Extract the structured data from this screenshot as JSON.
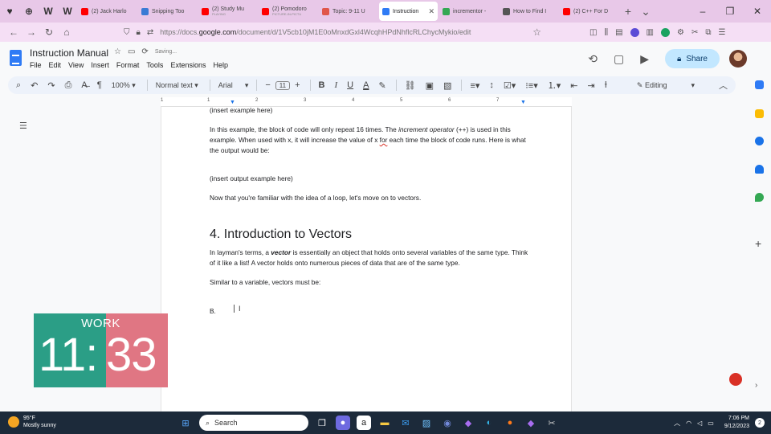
{
  "browser": {
    "tabs": [
      {
        "title": "(2) Jack Harlo",
        "color": "#ff0000",
        "subtitle": ""
      },
      {
        "title": "Snipping Too",
        "color": "#3a7bd5",
        "subtitle": ""
      },
      {
        "title": "(2) Study Mu",
        "color": "#ff0000",
        "subtitle": "PLAYING"
      },
      {
        "title": "(2) Pomodoro",
        "color": "#ff0000",
        "subtitle": "PICTURE-IN-PICTU"
      },
      {
        "title": "Topic: 9-11 U",
        "color": "#e0564a",
        "subtitle": ""
      },
      {
        "title": "Instruction",
        "color": "#2f7bf5",
        "subtitle": "",
        "active": true
      },
      {
        "title": "incrementor -",
        "color": "#34a853",
        "subtitle": ""
      },
      {
        "title": "How to Find I",
        "color": "#555555",
        "subtitle": ""
      },
      {
        "title": "(2) C++ For D",
        "color": "#ff0000",
        "subtitle": ""
      }
    ],
    "url_prefix": "https://docs.",
    "url_domain": "google.com",
    "url_path": "/document/d/1V5cb10jM1E0oMnxdGxl4WcqhHPdNhflcRLChycMykio/edit"
  },
  "doc": {
    "title": "Instruction Manual",
    "status": "Saving...",
    "menu": [
      "File",
      "Edit",
      "View",
      "Insert",
      "Format",
      "Tools",
      "Extensions",
      "Help"
    ],
    "share_label": "Share"
  },
  "toolbar": {
    "zoom": "100%",
    "style": "Normal text",
    "font": "Arial",
    "font_size": "11",
    "mode": "Editing"
  },
  "ruler": [
    "1",
    "1",
    "2",
    "3",
    "4",
    "5",
    "6",
    "7"
  ],
  "content": {
    "p1": "(insert example here)",
    "p2a": "In this example, the block of code will only repeat 16 times. The ",
    "p2em": "increment operator",
    "p2b": " (++) is used in this example. When used with x, it will increase the value of x ",
    "p2red": "for",
    "p2c": " each time the block of code runs. Here is what the output would be:",
    "p3": "(insert output example here)",
    "p4": "Now that you're familiar with the idea of a loop, let's move on to vectors.",
    "heading": "4. Introduction to Vectors",
    "p5a": "In layman's terms, a ",
    "p5em": "vector",
    "p5b": " is essentially an object that holds onto several variables of the same type. Think of it like a list! A vector holds onto numerous pieces of data that are of the same type.",
    "p6": "Similar to a variable, vectors must be:",
    "p7": "B."
  },
  "pomodoro": {
    "label": "WORK",
    "minutes": "11:",
    "seconds": "33",
    "work_color": "#2b9e86",
    "break_color": "#e07683"
  },
  "taskbar": {
    "temp": "95°F",
    "weather": "Mostly sunny",
    "search_placeholder": "Search",
    "time": "7:06 PM",
    "date": "9/12/2023",
    "notifications": "2"
  }
}
